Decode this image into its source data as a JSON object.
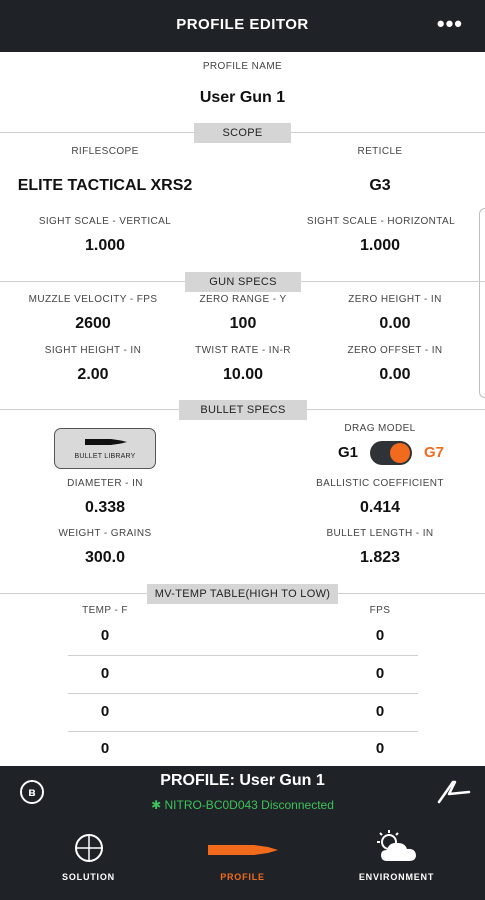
{
  "header": {
    "title": "PROFILE EDITOR",
    "more_icon": "more-dots-icon"
  },
  "profile_name": {
    "label": "PROFILE NAME",
    "value": "User Gun 1"
  },
  "scope": {
    "section": "SCOPE",
    "riflescope_label": "RIFLESCOPE",
    "riflescope_value": "ELITE TACTICAL XRS2",
    "reticle_label": "RETICLE",
    "reticle_value": "G3",
    "sight_scale_vertical_label": "SIGHT SCALE - VERTICAL",
    "sight_scale_vertical_value": "1.000",
    "sight_scale_horizontal_label": "SIGHT SCALE - HORIZONTAL",
    "sight_scale_horizontal_value": "1.000"
  },
  "gun_specs": {
    "section": "GUN SPECS",
    "muzzle_velocity_label": "MUZZLE VELOCITY - FPS",
    "muzzle_velocity_value": "2600",
    "zero_range_label": "ZERO RANGE - Y",
    "zero_range_value": "100",
    "zero_height_label": "ZERO HEIGHT - IN",
    "zero_height_value": "0.00",
    "sight_height_label": "SIGHT HEIGHT - IN",
    "sight_height_value": "2.00",
    "twist_rate_label": "TWIST RATE - IN-R",
    "twist_rate_value": "10.00",
    "zero_offset_label": "ZERO OFFSET - IN",
    "zero_offset_value": "0.00"
  },
  "bullet_specs": {
    "section": "BULLET SPECS",
    "library_button": "BULLET LIBRARY",
    "drag_model_label": "DRAG MODEL",
    "drag_g1": "G1",
    "drag_g7": "G7",
    "drag_selected": "G7",
    "diameter_label": "DIAMETER - IN",
    "diameter_value": "0.338",
    "bc_label": "BALLISTIC COEFFICIENT",
    "bc_value": "0.414",
    "weight_label": "WEIGHT - GRAINS",
    "weight_value": "300.0",
    "length_label": "BULLET LENGTH - IN",
    "length_value": "1.823"
  },
  "mv_temp": {
    "section": "MV-TEMP TABLE(HIGH TO LOW)",
    "temp_header": "TEMP - F",
    "fps_header": "FPS",
    "rows": [
      {
        "temp": "0",
        "fps": "0"
      },
      {
        "temp": "0",
        "fps": "0"
      },
      {
        "temp": "0",
        "fps": "0"
      },
      {
        "temp": "0",
        "fps": "0"
      }
    ]
  },
  "status": {
    "profile_title": "PROFILE: User Gun 1",
    "connection": "NITRO-BC0D043 Disconnected",
    "connection_color": "#3cc35a"
  },
  "nav": {
    "solution": "SOLUTION",
    "profile": "PROFILE",
    "environment": "ENVIRONMENT",
    "active": "profile"
  },
  "colors": {
    "bar_bg": "#1f2227",
    "accent": "#f26b1d",
    "section_bg": "#d5d5d5"
  }
}
